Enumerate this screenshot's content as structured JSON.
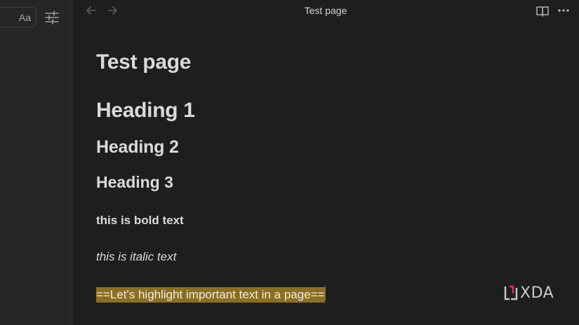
{
  "sidebar": {
    "font_button_label": "Aa",
    "settings_icon": "sliders-icon"
  },
  "topbar": {
    "back_icon": "arrow-left-icon",
    "forward_icon": "arrow-right-icon",
    "tab_title": "Test page",
    "reading_view_icon": "book-open-icon",
    "more_icon": "more-horizontal-icon"
  },
  "document": {
    "title": "Test page",
    "heading1": "Heading 1",
    "heading2": "Heading 2",
    "heading3": "Heading 3",
    "bold_text": "this is bold text",
    "italic_text": "this is italic text",
    "highlight_text": "==Let's highlight important text in a page=="
  },
  "watermark": {
    "text": "XDA",
    "accent_color": "#e2374a"
  },
  "colors": {
    "background": "#1e1e1e",
    "sidebar": "#262626",
    "text": "#dadada",
    "highlight": "#8c6f1e"
  }
}
